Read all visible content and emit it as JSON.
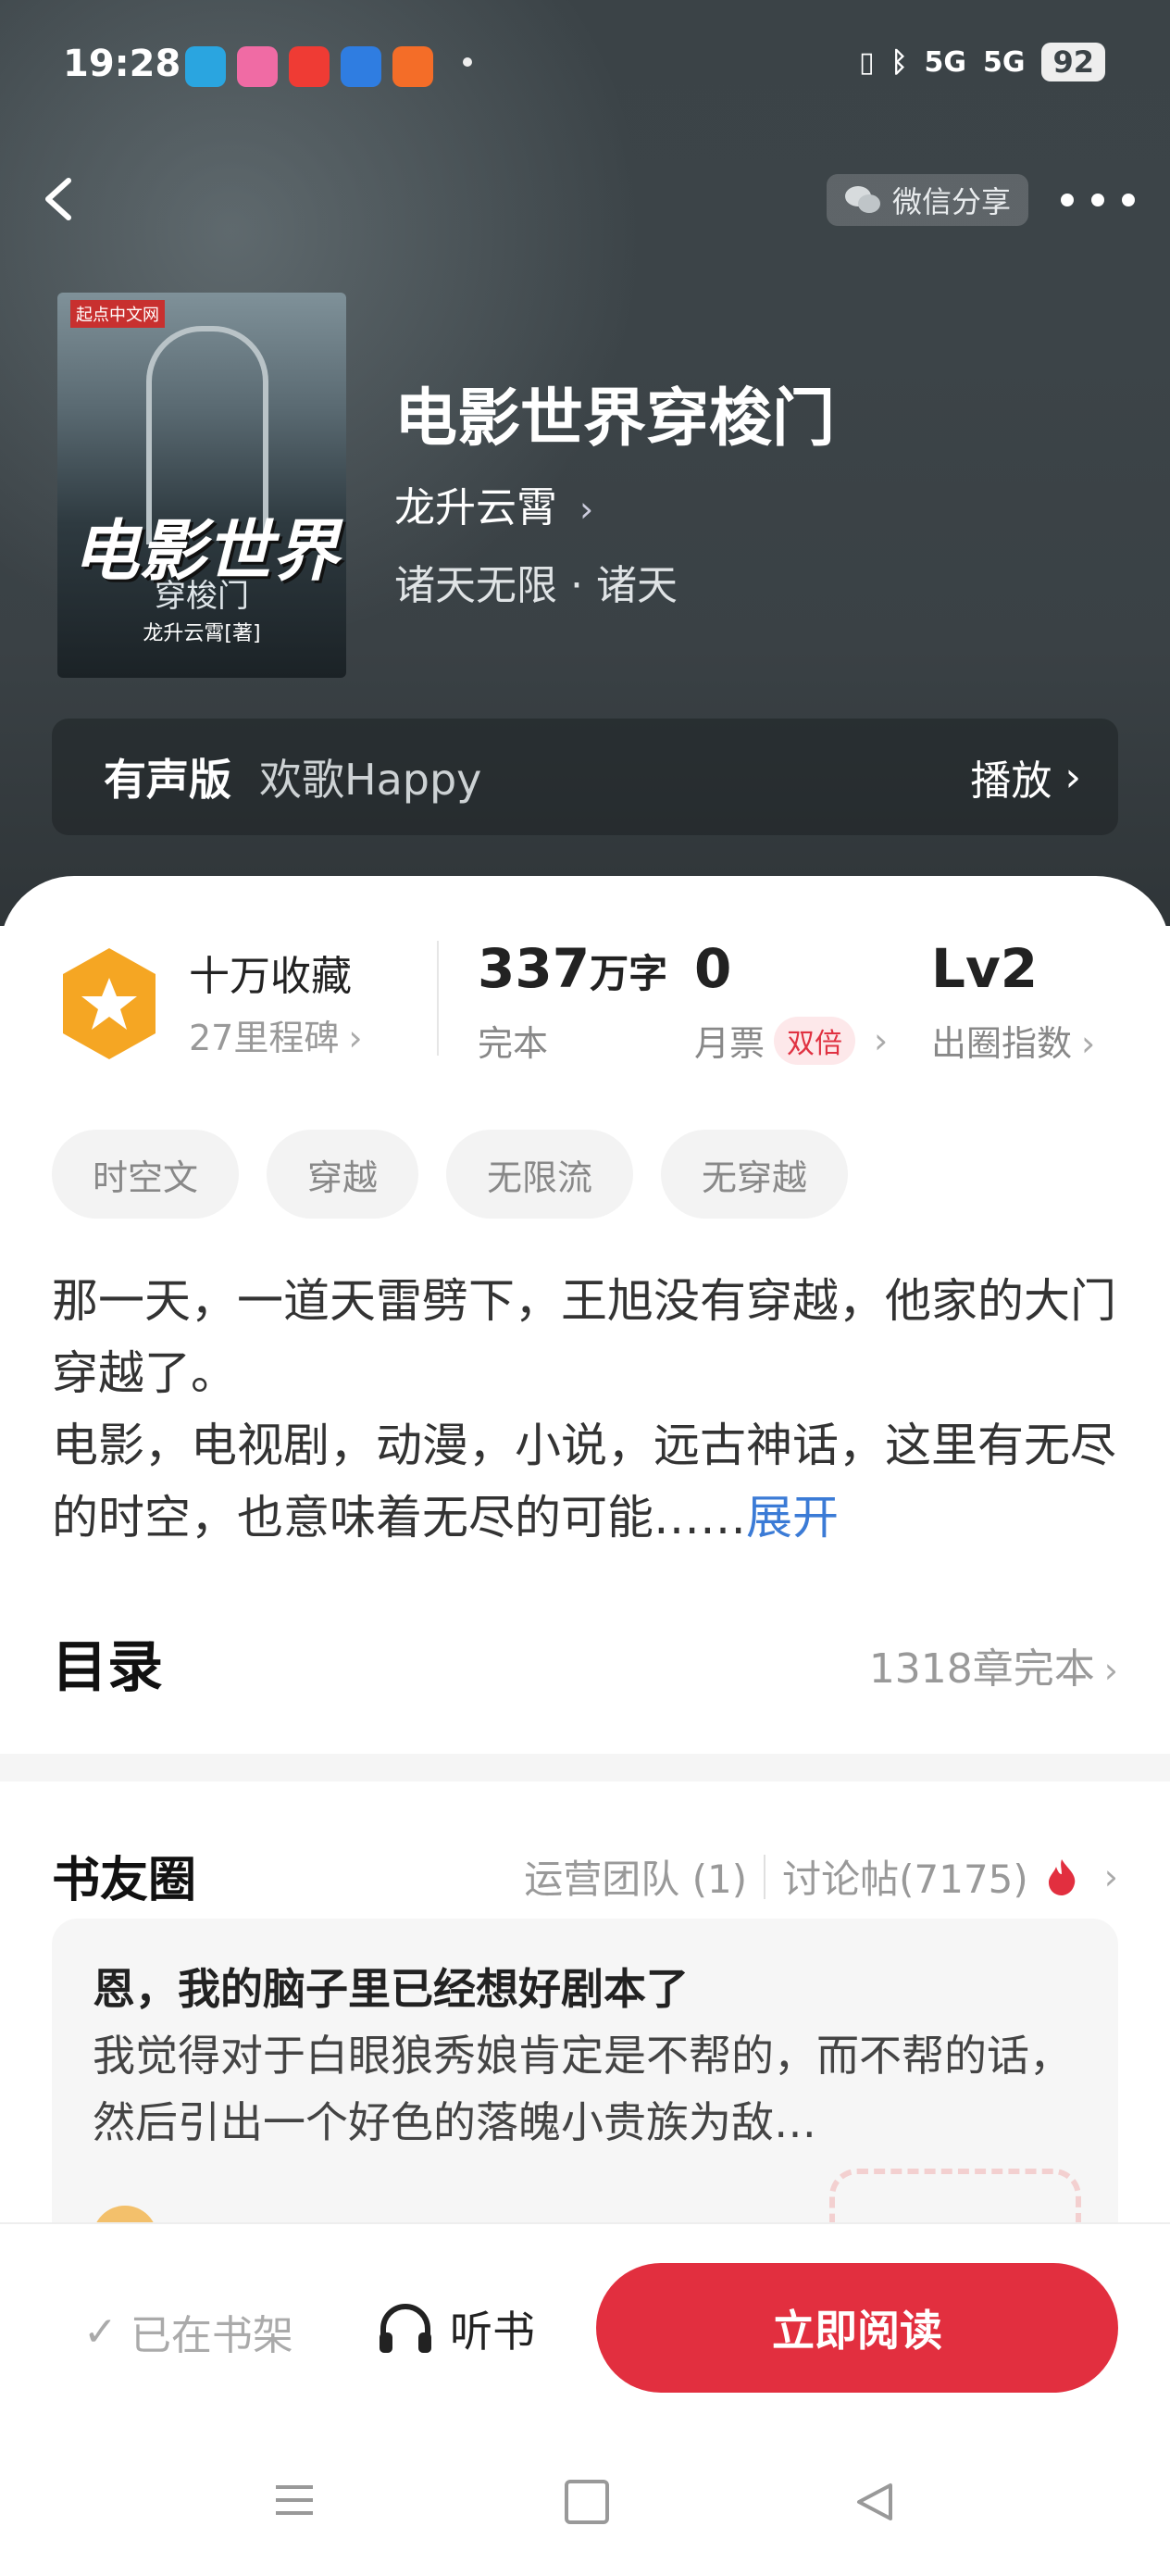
{
  "status_bar": {
    "time": "19:28",
    "network_a": "5G",
    "network_b": "5G",
    "battery": "92"
  },
  "header": {
    "share_label": "微信分享"
  },
  "book": {
    "cover_brand": "起点中文网",
    "cover_title": "电影世界",
    "cover_subtitle": "穿梭门",
    "cover_author": "龙升云霄[著]",
    "title": "电影世界穿梭门",
    "author": "龙升云霄",
    "genre": "诸天无限 · 诸天"
  },
  "audio": {
    "label": "有声版",
    "narrator": "欢歌Happy",
    "play_label": "播放"
  },
  "stats": {
    "collect_title": "十万收藏",
    "collect_sub": "27里程碑",
    "word_count": "337",
    "word_unit": "万字",
    "status": "完本",
    "monthly_votes": "0",
    "monthly_label": "月票",
    "monthly_badge": "双倍",
    "level": "Lv2",
    "level_label": "出圈指数"
  },
  "tags": [
    "时空文",
    "穿越",
    "无限流",
    "无穿越"
  ],
  "description": {
    "line1": "那一天，一道天雷劈下，王旭没有穿越，他家的大门穿越了。",
    "line2": "电影，电视剧，动漫，小说，远古神话，这里有无尽的时空，也意味着无尽的可能……",
    "expand": "展开"
  },
  "toc": {
    "title": "目录",
    "summary": "1318章完本"
  },
  "circle": {
    "title": "书友圈",
    "team": "运营团队 (1)",
    "posts": "讨论帖(7175)",
    "post_title": "恩，我的脑子里已经想好剧本了",
    "post_body": "我觉得对于白眼狼秀娘肯定是不帮的，而不帮的话，然后引出一个好色的落魄小贵族为敌…"
  },
  "bottom": {
    "on_shelf": "已在书架",
    "listen": "听书",
    "read_now": "立即阅读"
  },
  "colors": {
    "accent": "#e22f3f",
    "link": "#3b7bd6",
    "medal": "#f5a623"
  }
}
